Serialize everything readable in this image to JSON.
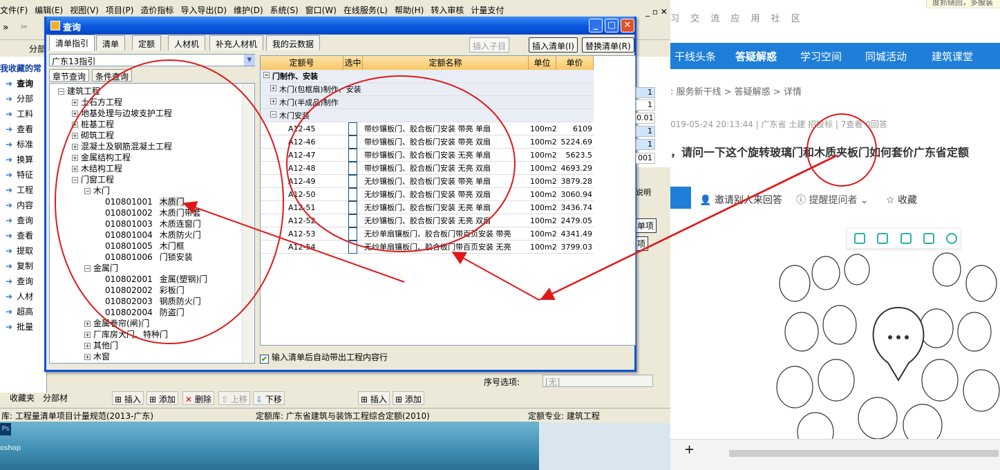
{
  "menubar": {
    "items": [
      "文件(F)",
      "编辑(E)",
      "视图(V)",
      "项目(P)",
      "造价指标",
      "导入导出(D)",
      "维护(D)",
      "系统(S)",
      "窗口(W)",
      "在线服务(L)",
      "帮助(H)",
      "转入审核",
      "计量支付"
    ]
  },
  "left_panel": {
    "header": "分部",
    "title": "我收藏的常",
    "items": [
      "查询",
      "分部",
      "工料",
      "查看",
      "标准",
      "换算",
      "特征",
      "工程",
      "内容",
      "查询",
      "查看",
      "提取",
      "复制",
      "查询",
      "人材",
      "超高",
      "批量"
    ]
  },
  "bottom_tabs": [
    "收藏夹",
    "分部材"
  ],
  "lower_toolbar": {
    "insert": "插入",
    "add": "添加",
    "delete": "删除",
    "up": "上移",
    "down": "下移",
    "insert2": "插入",
    "add2": "添加"
  },
  "right_numbers": [
    "1",
    "1",
    "0.01",
    "1",
    "1",
    "001"
  ],
  "lower_right": {
    "seq_label": "序号选项:",
    "seq_value": "[无]",
    "note": "说明",
    "label_a": "单项",
    "label_b": "项"
  },
  "status": {
    "lib1": "库: 工程量清单项目计量规范(2013-广东)",
    "lib2": "定额库: 广东省建筑与装饰工程综合定额(2010)",
    "major": "定额专业: 建筑工程"
  },
  "dialog": {
    "title": "查询",
    "tabs": [
      "清单指引",
      "清单",
      "定额",
      "人材机",
      "补充人材机",
      "我的云数据"
    ],
    "buttons": {
      "insert_child": "插入子目",
      "insert_list": "插入清单(I)",
      "replace_list": "替换清单(R)"
    },
    "library": "广东13指引",
    "tree_tabs": [
      "章节查询",
      "条件查询"
    ],
    "tree": [
      {
        "label": "建筑工程",
        "expanded": true
      },
      {
        "label": "土石方工程"
      },
      {
        "label": "地基处理与边坡支护工程"
      },
      {
        "label": "桩基工程"
      },
      {
        "label": "砌筑工程"
      },
      {
        "label": "混凝土及钢筋混凝土工程"
      },
      {
        "label": "金属结构工程"
      },
      {
        "label": "木结构工程"
      },
      {
        "label": "门窗工程",
        "expanded": true
      },
      {
        "label": "木门",
        "expanded": true
      },
      {
        "code": "010801001",
        "label": "木质门",
        "selected": true
      },
      {
        "code": "010801002",
        "label": "木质门带套"
      },
      {
        "code": "010801003",
        "label": "木质连窗门"
      },
      {
        "code": "010801004",
        "label": "木质防火门"
      },
      {
        "code": "010801005",
        "label": "木门框"
      },
      {
        "code": "010801006",
        "label": "门锁安装"
      },
      {
        "label": "金属门",
        "expanded": true
      },
      {
        "code": "010802001",
        "label": "金属(塑钢)门"
      },
      {
        "code": "010802002",
        "label": "彩板门"
      },
      {
        "code": "010802003",
        "label": "钢质防火门"
      },
      {
        "code": "010802004",
        "label": "防盗门"
      },
      {
        "label": "金属卷帘(闸)门"
      },
      {
        "label": "厂库房大门、特种门"
      },
      {
        "label": "其他门"
      },
      {
        "label": "木窗"
      }
    ],
    "grid_headers": [
      "定额号",
      "选中",
      "定额名称",
      "单位",
      "单价"
    ],
    "groups": [
      "门制作、安装",
      "木门(包框扇)制作、安装",
      "木门(半成品)制作",
      "木门安装"
    ],
    "rows": [
      {
        "code": "A12-45",
        "name": "带纱镶板门、胶合板门安装 带亮 单扇",
        "unit": "100m2",
        "price": "6109"
      },
      {
        "code": "A12-46",
        "name": "带纱镶板门、胶合板门安装 带亮 双扇",
        "unit": "100m2",
        "price": "5224.69"
      },
      {
        "code": "A12-47",
        "name": "带纱镶板门、胶合板门安装 无亮 单扇",
        "unit": "100m2",
        "price": "5623.5"
      },
      {
        "code": "A12-48",
        "name": "带纱镶板门、胶合板门安装 无亮 双扇",
        "unit": "100m2",
        "price": "4693.29"
      },
      {
        "code": "A12-49",
        "name": "无纱镶板门、胶合板门安装 带亮 单扇",
        "unit": "100m2",
        "price": "3879.28"
      },
      {
        "code": "A12-50",
        "name": "无纱镶板门、胶合板门安装 带亮 双扇",
        "unit": "100m2",
        "price": "3060.94"
      },
      {
        "code": "A12-51",
        "name": "无纱镶板门、胶合板门安装 无亮 单扇",
        "unit": "100m2",
        "price": "3436.74"
      },
      {
        "code": "A12-52",
        "name": "无纱镶板门、胶合板门安装 无亮 双扇",
        "unit": "100m2",
        "price": "2479.05"
      },
      {
        "code": "A12-53",
        "name": "无纱单扇镶板门、胶合板门带百页安装 带亮",
        "unit": "100m2",
        "price": "4341.49"
      },
      {
        "code": "A12-54",
        "name": "无纱单扇镶板门、胶合板门带百页安装 无亮",
        "unit": "100m2",
        "price": "3799.03"
      }
    ],
    "auto_check": "输入清单后自动带出工程内容行"
  },
  "web": {
    "subtitle": "习 交 流 应 用 社 区",
    "corner_note": "度抓绕回，多服装",
    "nav": [
      "干线头条",
      "答疑解惑",
      "学习空间",
      "同城活动",
      "建筑课堂"
    ],
    "crumb": ": 服务新干线 > 答疑解惑 > 详情",
    "meta": "019-05-24 20:13:44  |  广东省  土建 招投标  |  7查看  0回答",
    "question": "，请问一下这个旋转玻璃门和木质夹板门如何套价广东省定额",
    "actions": {
      "invite": "邀请别人来回答",
      "remind": "提醒提问者",
      "fav": "收藏"
    }
  },
  "desktop": {
    "ps_label": "oshop"
  },
  "colors": {
    "annotation_red": "#e01818",
    "title_blue": "#0a5ae0",
    "nav_blue": "#1f7fd8"
  }
}
